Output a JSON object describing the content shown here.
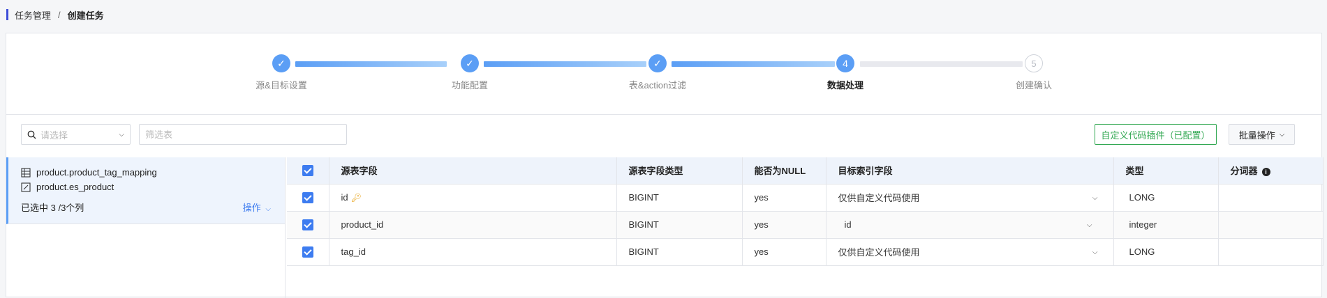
{
  "breadcrumb": {
    "parent": "任务管理",
    "separator": "/",
    "current": "创建任务"
  },
  "steps": [
    {
      "label": "源&目标设置",
      "status": "done",
      "marker": "✓"
    },
    {
      "label": "功能配置",
      "status": "done",
      "marker": "✓"
    },
    {
      "label": "表&action过滤",
      "status": "done",
      "marker": "✓"
    },
    {
      "label": "数据处理",
      "status": "active",
      "marker": "4"
    },
    {
      "label": "创建确认",
      "status": "todo",
      "marker": "5"
    }
  ],
  "toolbar": {
    "select_placeholder": "请选择",
    "filter_placeholder": "筛选表",
    "custom_plugin_button": "自定义代码插件（已配置）",
    "batch_button": "批量操作"
  },
  "table_item": {
    "source": "product.product_tag_mapping",
    "target": "product.es_product",
    "selected_count": "已选中 3 /3个列",
    "action": "操作"
  },
  "grid": {
    "headers": [
      "源表字段",
      "源表字段类型",
      "能否为NULL",
      "目标索引字段",
      "类型",
      "分词器"
    ],
    "rows": [
      {
        "field": "id",
        "type": "BIGINT",
        "nullable": "yes",
        "target": "仅供自定义代码使用",
        "target_type": "LONG",
        "analyzer": "",
        "is_key": true
      },
      {
        "field": "product_id",
        "type": "BIGINT",
        "nullable": "yes",
        "target": "id",
        "target_type": "integer",
        "analyzer": "",
        "is_key": false
      },
      {
        "field": "tag_id",
        "type": "BIGINT",
        "nullable": "yes",
        "target": "仅供自定义代码使用",
        "target_type": "LONG",
        "analyzer": "",
        "is_key": false
      }
    ]
  },
  "colors": {
    "accent": "#5b9ef5",
    "link": "#3d7cf0",
    "success": "#32a852"
  }
}
